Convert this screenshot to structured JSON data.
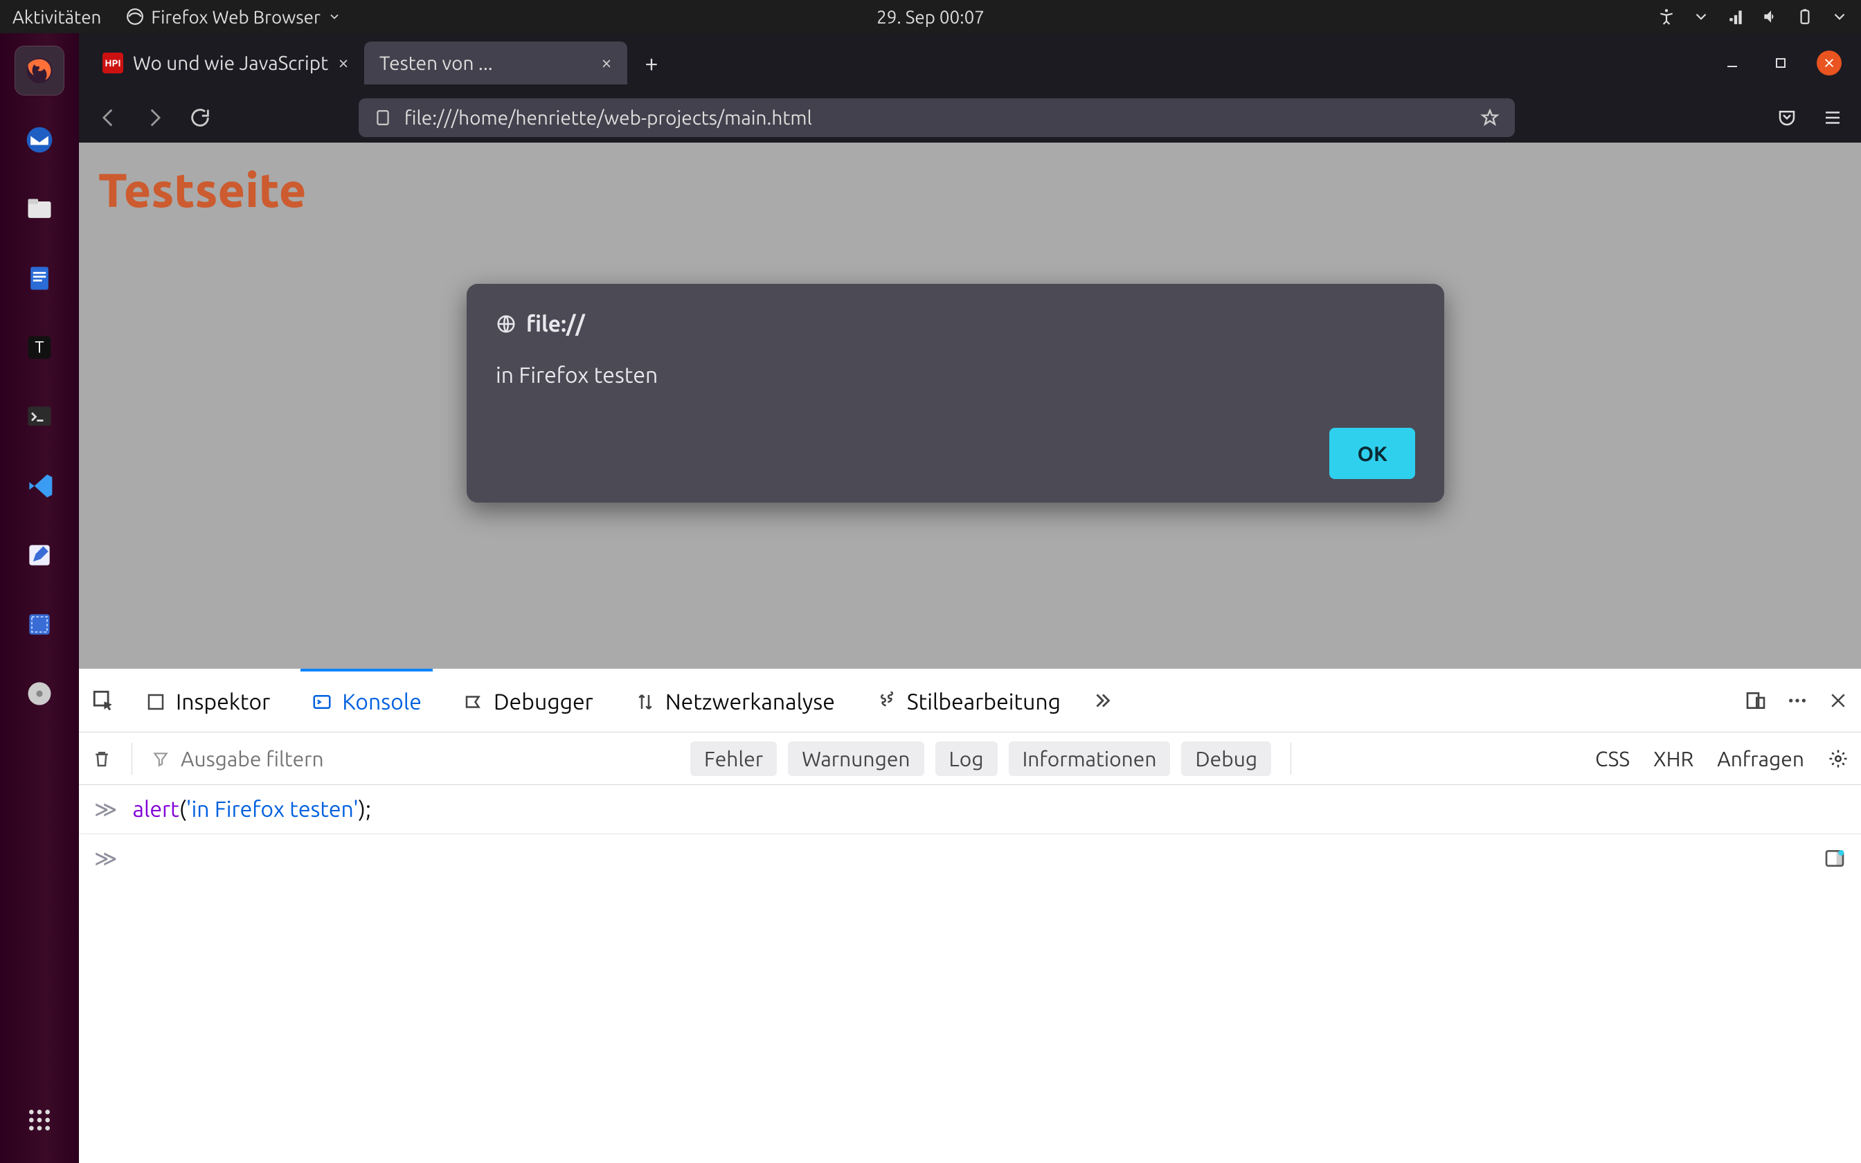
{
  "gnome": {
    "activities": "Aktivitäten",
    "app_menu": "Firefox Web Browser",
    "clock": "29. Sep  00:07"
  },
  "tabs": [
    {
      "title": "Wo und wie JavaScript",
      "active": false
    },
    {
      "title": "Testen von ...",
      "active": true
    }
  ],
  "url": "file:///home/henriette/web-projects/main.html",
  "page": {
    "heading": "Testseite"
  },
  "alert": {
    "origin": "file://",
    "message": "in Firefox testen",
    "ok": "OK"
  },
  "devtools": {
    "tabs": {
      "inspector": "Inspektor",
      "console": "Konsole",
      "debugger": "Debugger",
      "network": "Netzwerkanalyse",
      "style": "Stilbearbeitung"
    },
    "filter_placeholder": "Ausgabe filtern",
    "pills": {
      "errors": "Fehler",
      "warnings": "Warnungen",
      "log": "Log",
      "info": "Informationen",
      "debug": "Debug"
    },
    "rlinks": {
      "css": "CSS",
      "xhr": "XHR",
      "requests": "Anfragen"
    },
    "code": {
      "fn": "alert",
      "str": "'in Firefox testen'"
    }
  }
}
